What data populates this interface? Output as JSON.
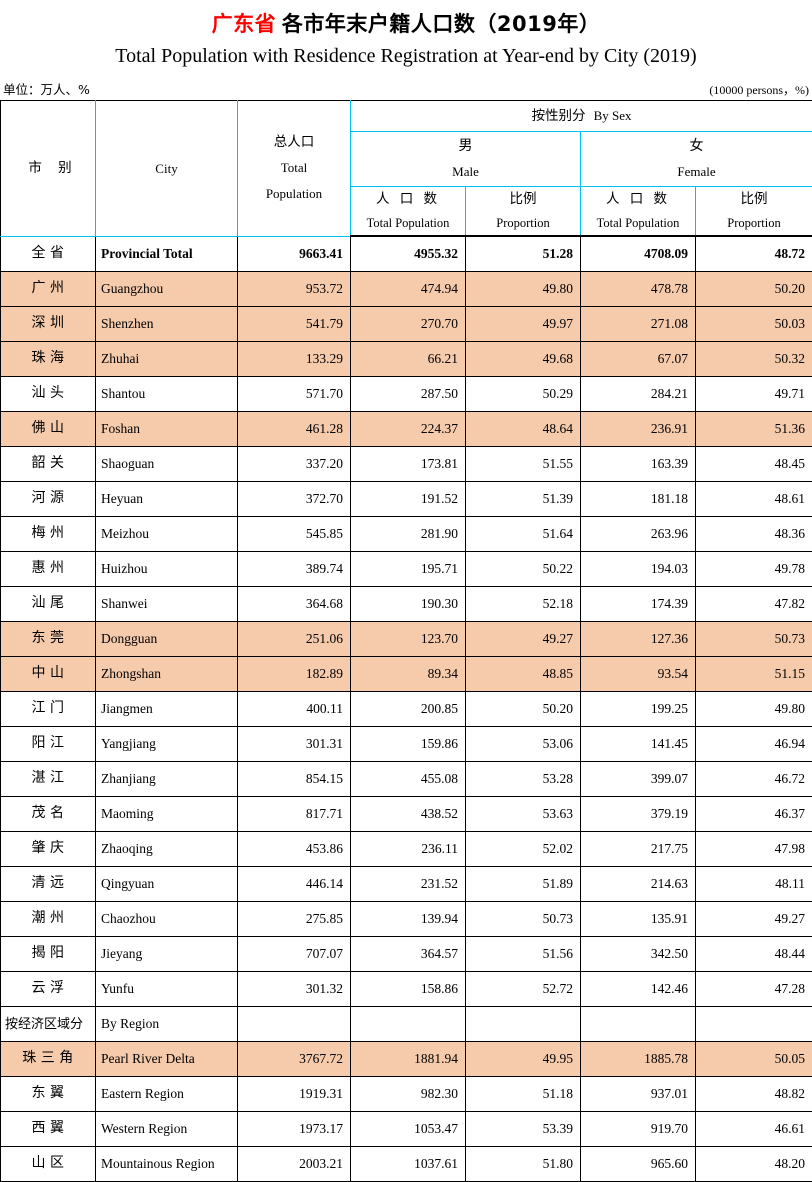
{
  "title": {
    "zh_prefix": "广东省",
    "zh_rest": "各市年末户籍人口数（2019年）",
    "en": "Total Population with Residence Registration at Year-end by City (2019)"
  },
  "unit": {
    "left": "单位：万人、%",
    "right": "(10000 persons，%)"
  },
  "header": {
    "city_zh": "市  别",
    "city_en": "City",
    "total_pop_zh": "总人口",
    "total_pop_en_l1": "Total",
    "total_pop_en_l2": "Population",
    "by_sex_zh": "按性别分",
    "by_sex_en": "By Sex",
    "male_zh": "男",
    "male_en": "Male",
    "female_zh": "女",
    "female_en": "Female",
    "pop_count_zh": "人 口 数",
    "pop_count_en": "Total Population",
    "proportion_zh": "比例",
    "proportion_en": "Proportion"
  },
  "columns": [
    "市  别",
    "City",
    "总人口 Total Population",
    "男 人口数 Total Population",
    "男 比例 Proportion",
    "女 人口数 Total Population",
    "女 比例 Proportion"
  ],
  "rows": [
    {
      "zh": "全  省",
      "en": "Provincial Total",
      "total": "9663.41",
      "male": "4955.32",
      "male_pct": "51.28",
      "female": "4708.09",
      "female_pct": "48.72",
      "style": "total"
    },
    {
      "zh": "广  州",
      "en": "Guangzhou",
      "total": "953.72",
      "male": "474.94",
      "male_pct": "49.80",
      "female": "478.78",
      "female_pct": "50.20",
      "style": "hl"
    },
    {
      "zh": "深  圳",
      "en": "Shenzhen",
      "total": "541.79",
      "male": "270.70",
      "male_pct": "49.97",
      "female": "271.08",
      "female_pct": "50.03",
      "style": "hl"
    },
    {
      "zh": "珠  海",
      "en": "Zhuhai",
      "total": "133.29",
      "male": "66.21",
      "male_pct": "49.68",
      "female": "67.07",
      "female_pct": "50.32",
      "style": "hl"
    },
    {
      "zh": "汕  头",
      "en": "Shantou",
      "total": "571.70",
      "male": "287.50",
      "male_pct": "50.29",
      "female": "284.21",
      "female_pct": "49.71",
      "style": ""
    },
    {
      "zh": "佛  山",
      "en": "Foshan",
      "total": "461.28",
      "male": "224.37",
      "male_pct": "48.64",
      "female": "236.91",
      "female_pct": "51.36",
      "style": "hl"
    },
    {
      "zh": "韶  关",
      "en": "Shaoguan",
      "total": "337.20",
      "male": "173.81",
      "male_pct": "51.55",
      "female": "163.39",
      "female_pct": "48.45",
      "style": ""
    },
    {
      "zh": "河  源",
      "en": "Heyuan",
      "total": "372.70",
      "male": "191.52",
      "male_pct": "51.39",
      "female": "181.18",
      "female_pct": "48.61",
      "style": ""
    },
    {
      "zh": "梅  州",
      "en": "Meizhou",
      "total": "545.85",
      "male": "281.90",
      "male_pct": "51.64",
      "female": "263.96",
      "female_pct": "48.36",
      "style": ""
    },
    {
      "zh": "惠  州",
      "en": "Huizhou",
      "total": "389.74",
      "male": "195.71",
      "male_pct": "50.22",
      "female": "194.03",
      "female_pct": "49.78",
      "style": ""
    },
    {
      "zh": "汕  尾",
      "en": "Shanwei",
      "total": "364.68",
      "male": "190.30",
      "male_pct": "52.18",
      "female": "174.39",
      "female_pct": "47.82",
      "style": ""
    },
    {
      "zh": "东  莞",
      "en": "Dongguan",
      "total": "251.06",
      "male": "123.70",
      "male_pct": "49.27",
      "female": "127.36",
      "female_pct": "50.73",
      "style": "hl"
    },
    {
      "zh": "中  山",
      "en": "Zhongshan",
      "total": "182.89",
      "male": "89.34",
      "male_pct": "48.85",
      "female": "93.54",
      "female_pct": "51.15",
      "style": "hl"
    },
    {
      "zh": "江  门",
      "en": "Jiangmen",
      "total": "400.11",
      "male": "200.85",
      "male_pct": "50.20",
      "female": "199.25",
      "female_pct": "49.80",
      "style": ""
    },
    {
      "zh": "阳  江",
      "en": "Yangjiang",
      "total": "301.31",
      "male": "159.86",
      "male_pct": "53.06",
      "female": "141.45",
      "female_pct": "46.94",
      "style": ""
    },
    {
      "zh": "湛  江",
      "en": "Zhanjiang",
      "total": "854.15",
      "male": "455.08",
      "male_pct": "53.28",
      "female": "399.07",
      "female_pct": "46.72",
      "style": ""
    },
    {
      "zh": "茂  名",
      "en": "Maoming",
      "total": "817.71",
      "male": "438.52",
      "male_pct": "53.63",
      "female": "379.19",
      "female_pct": "46.37",
      "style": ""
    },
    {
      "zh": "肇  庆",
      "en": "Zhaoqing",
      "total": "453.86",
      "male": "236.11",
      "male_pct": "52.02",
      "female": "217.75",
      "female_pct": "47.98",
      "style": ""
    },
    {
      "zh": "清  远",
      "en": "Qingyuan",
      "total": "446.14",
      "male": "231.52",
      "male_pct": "51.89",
      "female": "214.63",
      "female_pct": "48.11",
      "style": ""
    },
    {
      "zh": "潮  州",
      "en": "Chaozhou",
      "total": "275.85",
      "male": "139.94",
      "male_pct": "50.73",
      "female": "135.91",
      "female_pct": "49.27",
      "style": ""
    },
    {
      "zh": "揭  阳",
      "en": "Jieyang",
      "total": "707.07",
      "male": "364.57",
      "male_pct": "51.56",
      "female": "342.50",
      "female_pct": "48.44",
      "style": ""
    },
    {
      "zh": "云  浮",
      "en": "Yunfu",
      "total": "301.32",
      "male": "158.86",
      "male_pct": "52.72",
      "female": "142.46",
      "female_pct": "47.28",
      "style": ""
    },
    {
      "zh": "按经济区域分",
      "en": "By Region",
      "total": "",
      "male": "",
      "male_pct": "",
      "female": "",
      "female_pct": "",
      "style": "section"
    },
    {
      "zh": "珠 三 角",
      "en": "Pearl River Delta",
      "total": "3767.72",
      "male": "1881.94",
      "male_pct": "49.95",
      "female": "1885.78",
      "female_pct": "50.05",
      "style": "hl"
    },
    {
      "zh": "东  翼",
      "en": "Eastern Region",
      "total": "1919.31",
      "male": "982.30",
      "male_pct": "51.18",
      "female": "937.01",
      "female_pct": "48.82",
      "style": ""
    },
    {
      "zh": "西  翼",
      "en": "Western Region",
      "total": "1973.17",
      "male": "1053.47",
      "male_pct": "53.39",
      "female": "919.70",
      "female_pct": "46.61",
      "style": ""
    },
    {
      "zh": "山  区",
      "en": "Mountainous Region",
      "total": "2003.21",
      "male": "1037.61",
      "male_pct": "51.80",
      "female": "965.60",
      "female_pct": "48.20",
      "style": ""
    }
  ],
  "colors": {
    "title_accent": "#ff0000",
    "highlight_row": "#f6cbac",
    "header_rule": "#00c0f0",
    "outer_rule": "#000000"
  }
}
